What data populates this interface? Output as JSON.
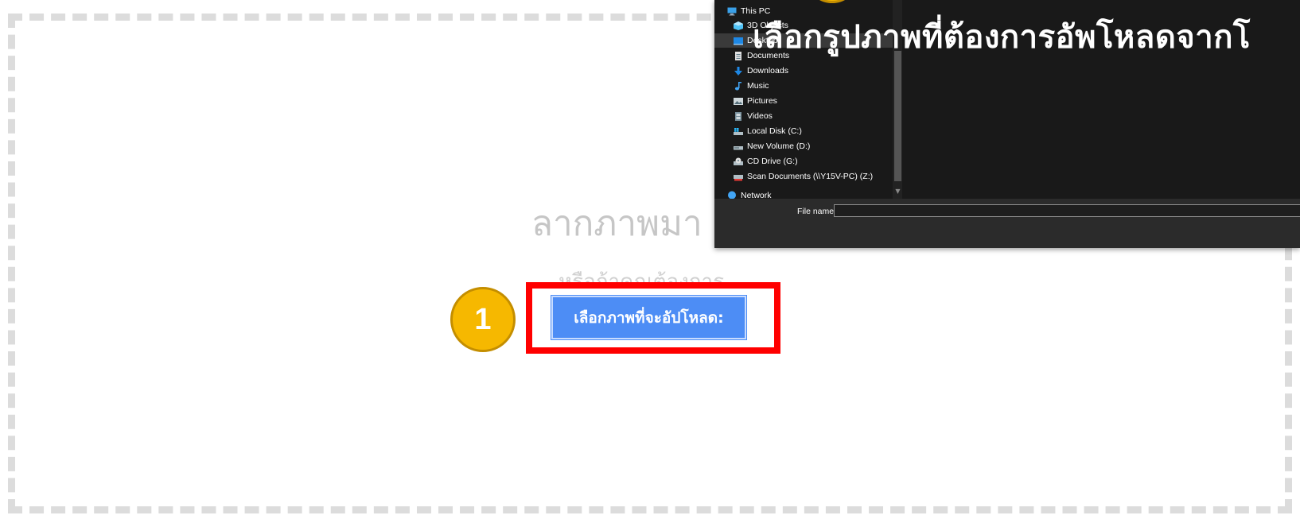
{
  "dropzone": {
    "title": "ลากภาพมา",
    "subtitle": "หรือถ้าคุณต้องการ",
    "upload_button": "เลือกภาพที่จะอัปโหลด:",
    "step_number": "1"
  },
  "dialog": {
    "overlay_heading": "เลือกรูปภาพที่ต้องการอัพโหลดจากโ",
    "nav_items": [
      {
        "label": "This PC",
        "icon": "pc-icon"
      },
      {
        "label": "3D Objects",
        "icon": "cube-icon"
      },
      {
        "label": "Desktop",
        "icon": "desktop-icon"
      },
      {
        "label": "Documents",
        "icon": "document-icon"
      },
      {
        "label": "Downloads",
        "icon": "download-arrow-icon"
      },
      {
        "label": "Music",
        "icon": "music-note-icon"
      },
      {
        "label": "Pictures",
        "icon": "picture-icon"
      },
      {
        "label": "Videos",
        "icon": "film-icon"
      },
      {
        "label": "Local Disk (C:)",
        "icon": "windows-drive-icon"
      },
      {
        "label": "New Volume (D:)",
        "icon": "drive-icon"
      },
      {
        "label": "CD Drive (G:)",
        "icon": "cd-drive-icon"
      },
      {
        "label": "Scan Documents (\\\\Y15V-PC) (Z:)",
        "icon": "network-drive-icon"
      },
      {
        "label": "Network",
        "icon": "network-icon"
      }
    ],
    "file_name_label": "File name:",
    "file_name_value": ""
  },
  "colors": {
    "button": "#4d8df5",
    "highlight": "#ff0000",
    "badge": "#f6b800",
    "dialog_bg": "#191919"
  }
}
